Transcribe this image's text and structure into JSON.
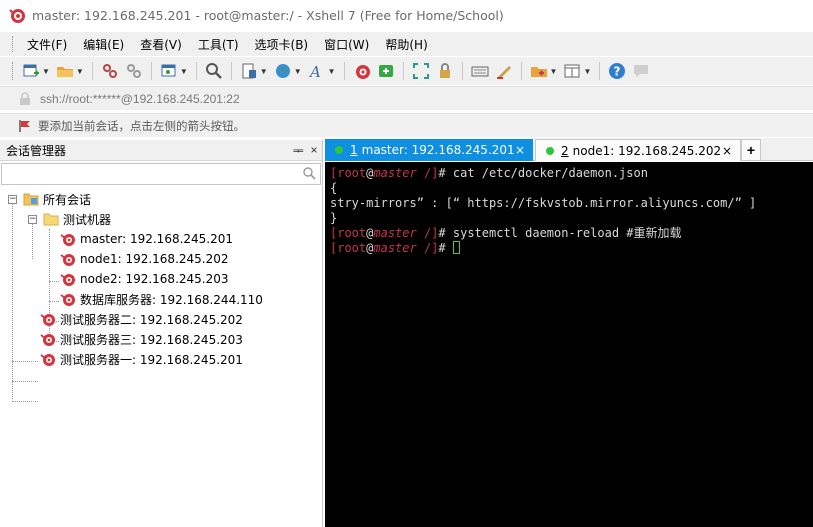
{
  "window": {
    "title": "master: 192.168.245.201 - root@master:/ - Xshell 7 (Free for Home/School)"
  },
  "menu": {
    "items": [
      "文件(F)",
      "编辑(E)",
      "查看(V)",
      "工具(T)",
      "选项卡(B)",
      "窗口(W)",
      "帮助(H)"
    ]
  },
  "toolbar": {
    "icons": [
      "new-session-icon",
      "open-folder-icon",
      "reconnect-icon",
      "disconnect-icon",
      "new-window-icon",
      "find-icon",
      "transfer-icon",
      "globe-icon",
      "font-icon",
      "xshell-icon",
      "xftp-icon",
      "fullscreen-icon",
      "lock-icon",
      "keyboard-icon",
      "compose-icon",
      "add-folder-icon",
      "layout-icon",
      "help-icon",
      "chat-icon"
    ]
  },
  "address": {
    "text": "ssh://root:******@192.168.245.201:22"
  },
  "hint": {
    "text": "要添加当前会话，点击左侧的箭头按钮。"
  },
  "session_manager": {
    "title": "会话管理器",
    "pin": "ᆍ",
    "close": "×",
    "search_value": "",
    "tree": {
      "root": "所有会话",
      "group": "测试机器",
      "group_items": [
        "master: 192.168.245.201",
        "node1: 192.168.245.202",
        "node2: 192.168.245.203",
        "数据库服务器: 192.168.244.110"
      ],
      "top_items": [
        "测试服务器二: 192.168.245.202",
        "测试服务器三: 192.168.245.203",
        "测试服务器一: 192.168.245.201"
      ]
    }
  },
  "tabs": {
    "items": [
      {
        "num": "1",
        "label": "master: 192.168.245.201",
        "close": "×"
      },
      {
        "num": "2",
        "label": "node1: 192.168.245.202",
        "close": "×"
      }
    ],
    "add": "+"
  },
  "terminal": {
    "prompt": {
      "user": "root",
      "at": "@",
      "host": "master",
      "dir": "/"
    },
    "lines": [
      {
        "type": "cmd",
        "text": "cat /etc/docker/daemon.json"
      },
      {
        "type": "out",
        "text": "{"
      },
      {
        "type": "out",
        "text": "stry-mirrors” : [“ https://fskvstob.mirror.aliyuncs.com/” ]"
      },
      {
        "type": "out",
        "text": "}"
      },
      {
        "type": "cmd",
        "text": "systemctl daemon-reload #重新加载"
      },
      {
        "type": "cursor",
        "text": ""
      }
    ]
  },
  "colors": {
    "tab_active": "#0e8fe0",
    "prompt_red": "#c6344b",
    "status_green": "#2fc73a",
    "terminal_bg": "#000000"
  }
}
